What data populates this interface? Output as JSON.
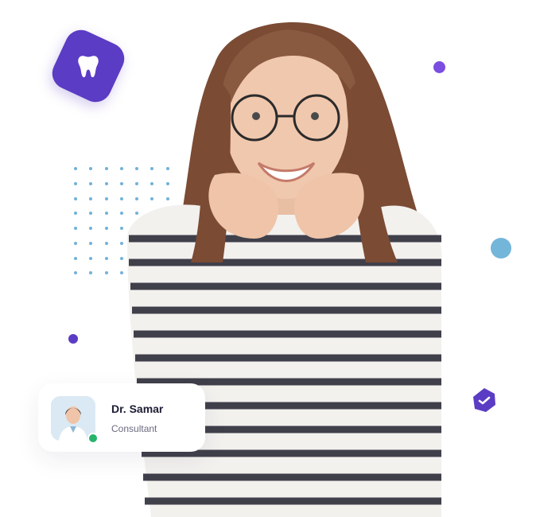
{
  "doctor_card": {
    "name": "Dr. Samar",
    "role": "Consultant",
    "status": "online"
  },
  "colors": {
    "brand_purple": "#5b3cc4",
    "accent_purple": "#7b4de0",
    "accent_blue": "#74b5da",
    "online_green": "#26b36a"
  },
  "icons": {
    "badge": "tooth-icon",
    "blob": "check-icon"
  }
}
